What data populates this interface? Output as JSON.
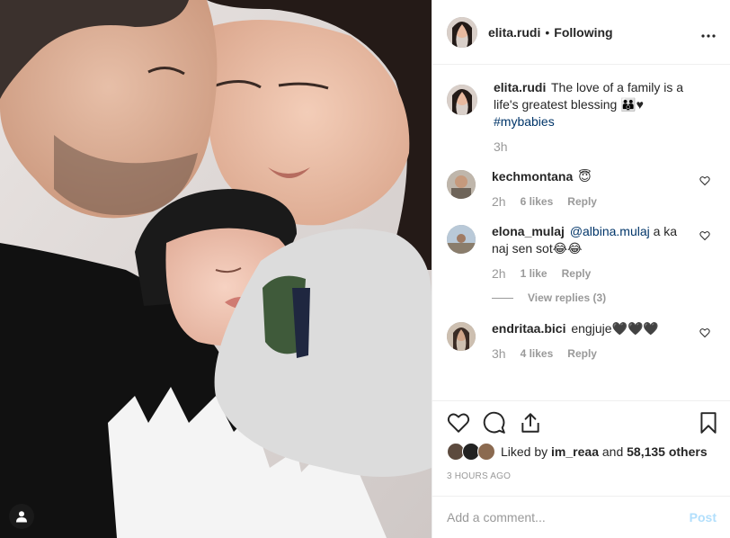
{
  "post": {
    "username": "elita.rudi",
    "separator": "•",
    "follow_state": "Following",
    "more_icon": "more-icon"
  },
  "caption": {
    "username": "elita.rudi",
    "text": "The love of a family is a life's greatest blessing 👪♥",
    "hashtag": "#mybabies",
    "time": "3h"
  },
  "comments": [
    {
      "username": "kechmontana",
      "text": "😇",
      "time": "2h",
      "likes": "6 likes",
      "reply": "Reply"
    },
    {
      "username": "elona_mulaj",
      "mention": "@albina.mulaj",
      "text": "a ka naj sen sot😂😂",
      "time": "2h",
      "likes": "1 like",
      "reply": "Reply"
    },
    {
      "username": "endritaa.bici",
      "text": "engjuje🖤🖤🖤",
      "time": "3h",
      "likes": "4 likes",
      "reply": "Reply"
    }
  ],
  "view_replies": "View replies (3)",
  "likes": {
    "prefix": "Liked by",
    "user": "im_reaa",
    "middle": "and",
    "count": "58,135 others"
  },
  "posted_ago": "3 HOURS AGO",
  "add_comment": {
    "placeholder": "Add a comment...",
    "post_label": "Post"
  },
  "colors": {
    "link": "#003569",
    "muted": "#999999",
    "post_disabled": "#b2dffc"
  }
}
